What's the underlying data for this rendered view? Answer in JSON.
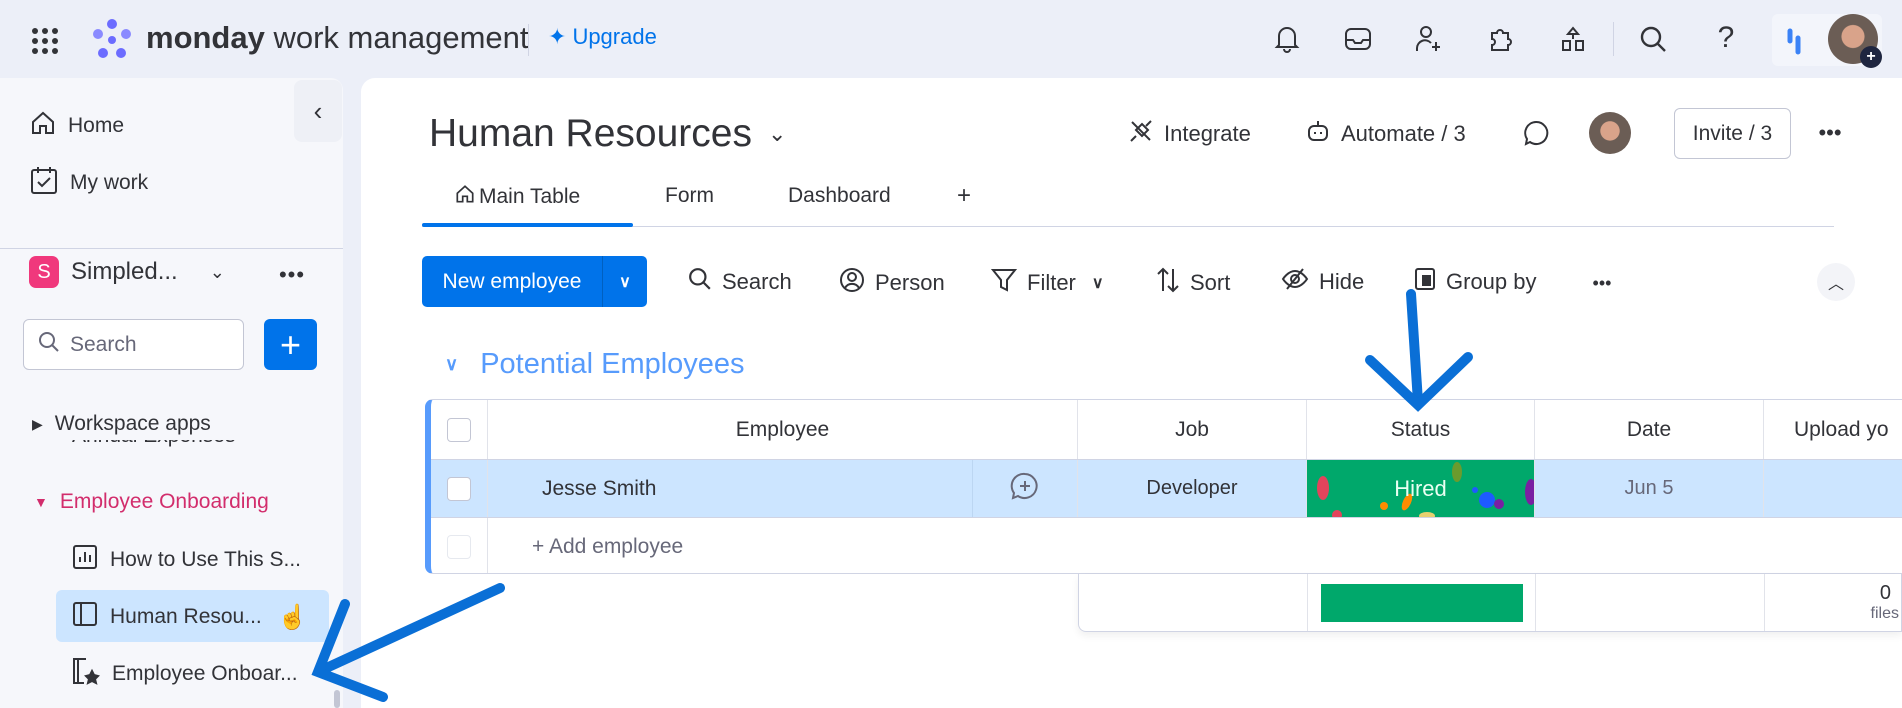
{
  "topbar": {
    "brand_bold": "monday",
    "brand_rest": "work management",
    "upgrade_label": "Upgrade",
    "icons": [
      "apps-grid-icon",
      "bell-icon",
      "inbox-icon",
      "invite-member-icon",
      "puzzle-icon",
      "apps-marketplace-icon",
      "search-icon",
      "help-icon",
      "ai-assistant-icon",
      "user-avatar"
    ]
  },
  "sidebar": {
    "home": "Home",
    "my_work": "My work",
    "workspace": {
      "badge": "S",
      "name": "Simpled...",
      "badge_color": "#e2445c"
    },
    "search_placeholder": "Search",
    "workspace_apps": "Workspace apps",
    "clipped_item": "Annual Expenses",
    "folder": "Employee Onboarding",
    "items": [
      {
        "label": "How to Use This S...",
        "icon": "dashboard-icon"
      },
      {
        "label": "Human Resou...",
        "icon": "board-icon",
        "selected": true
      },
      {
        "label": "Employee Onboar...",
        "icon": "workdoc-icon"
      }
    ]
  },
  "board": {
    "title": "Human Resources",
    "integrate": "Integrate",
    "automate": "Automate / 3",
    "invite": "Invite / 3",
    "tabs": [
      {
        "label": "Main Table",
        "active": true
      },
      {
        "label": "Form"
      },
      {
        "label": "Dashboard"
      },
      {
        "label": "+"
      }
    ],
    "toolbar": {
      "new_item": "New employee",
      "search": "Search",
      "person": "Person",
      "filter": "Filter",
      "sort": "Sort",
      "hide": "Hide",
      "group_by": "Group by"
    },
    "group": {
      "title": "Potential Employees",
      "color": "#579bfc",
      "columns": [
        "Employee",
        "Job",
        "Status",
        "Date",
        "Upload yo"
      ],
      "rows": [
        {
          "employee": "Jesse Smith",
          "job": "Developer",
          "status": "Hired",
          "status_color": "#00a86b",
          "date": "Jun 5"
        }
      ],
      "add_item": "+ Add employee",
      "summary": {
        "status_hired_fraction": 1.0,
        "files_count": "0",
        "files_label": "files"
      }
    }
  },
  "accent": "#0073ea"
}
